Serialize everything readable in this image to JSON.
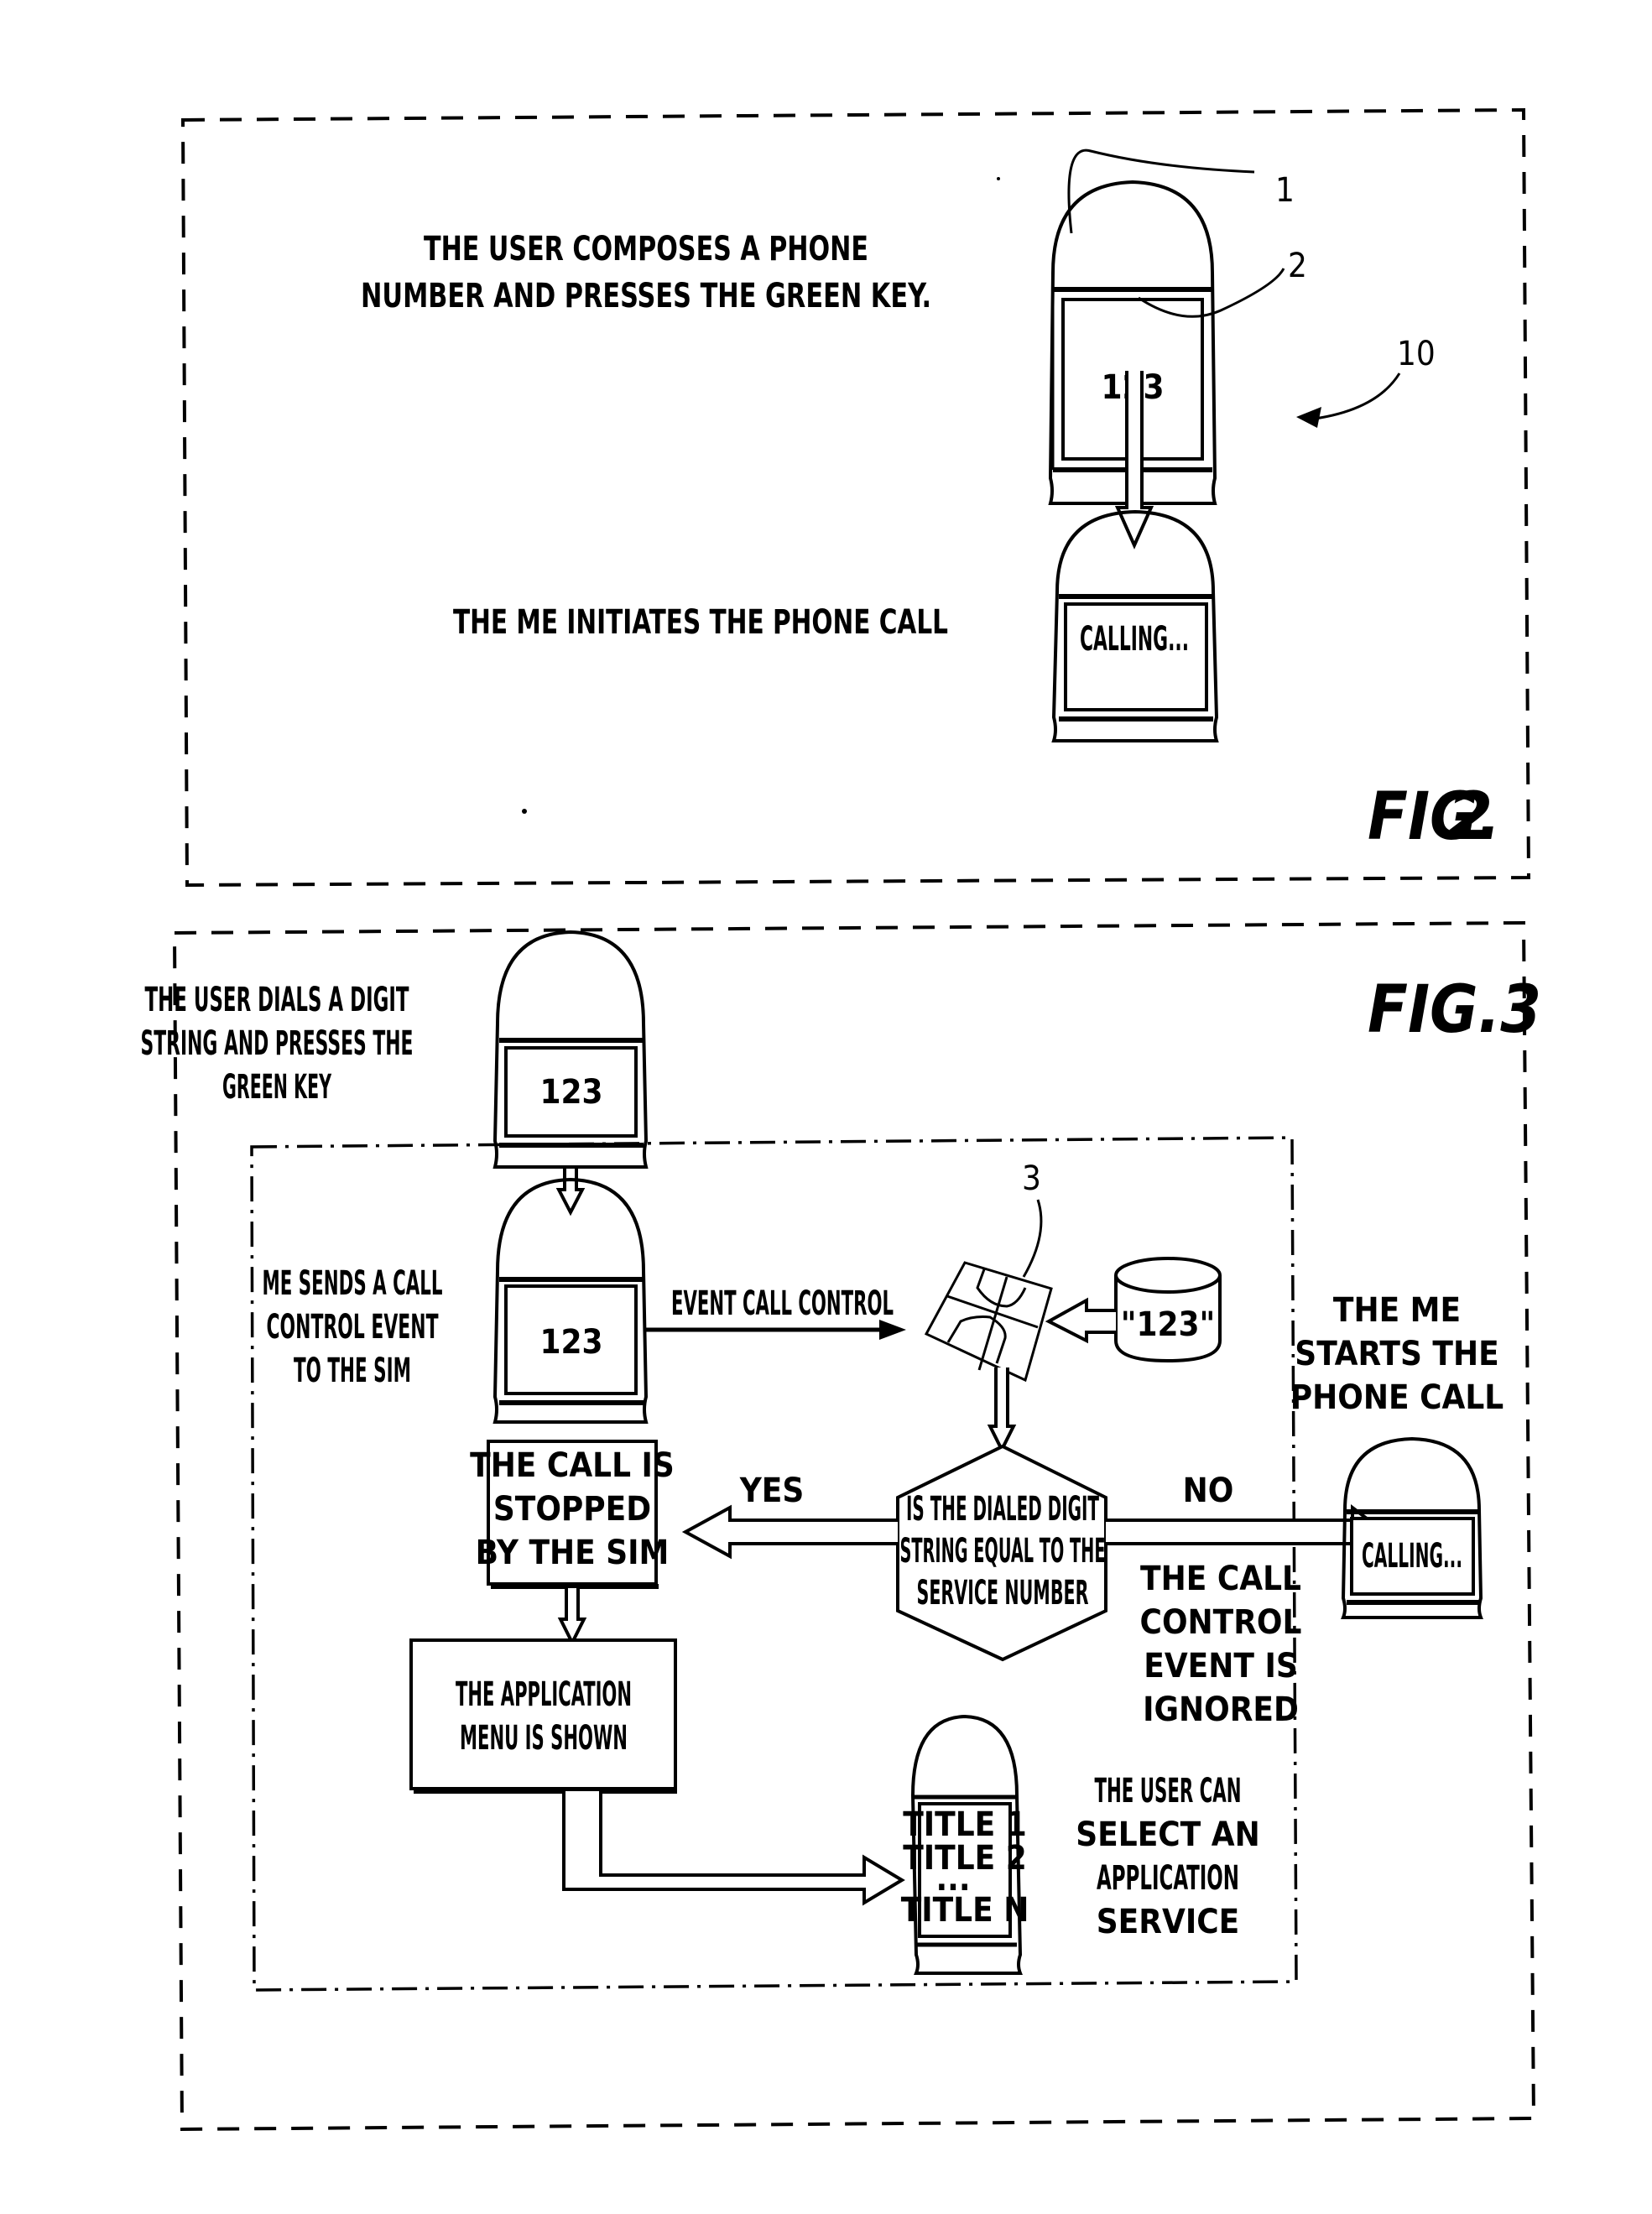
{
  "fig2": {
    "label": "FIG. 2",
    "label_prefix": "FIG.",
    "label_num": "2",
    "step1_text": [
      "THE USER COMPOSES A PHONE",
      "NUMBER AND PRESSES THE GREEN KEY."
    ],
    "phone1_screen": "123",
    "step2_text": "THE ME INITIATES THE PHONE CALL",
    "phone2_screen": "CALLING...",
    "ref_phone": "1",
    "ref_screen": "2",
    "ref_system": "10"
  },
  "fig3": {
    "label": "FIG.3",
    "dial_text": [
      "THE USER DIALS A DIGIT",
      "STRING AND PRESSES THE",
      "GREEN KEY"
    ],
    "dial_screen": "123",
    "send_text": [
      "ME SENDS A CALL",
      "CONTROL EVENT",
      "TO THE SIM"
    ],
    "send_screen": "123",
    "event_label": "EVENT CALL CONTROL",
    "sim_ref": "3",
    "db_value": "\"123\"",
    "decision_text": [
      "IS THE DIALED DIGIT",
      "STRING EQUAL TO THE",
      "SERVICE NUMBER"
    ],
    "yes_label": "YES",
    "no_label": "NO",
    "stopped_text": [
      "THE CALL IS",
      "STOPPED",
      "BY THE SIM"
    ],
    "menu_text": [
      "THE APPLICATION",
      "MENU IS SHOWN"
    ],
    "start_text": [
      "THE ME",
      "STARTS THE",
      "PHONE CALL"
    ],
    "calling_screen": "CALLING...",
    "ignored_text": [
      "THE CALL",
      "CONTROL",
      "EVENT IS",
      "IGNORED"
    ],
    "menu_items": [
      "TITLE 1",
      "TITLE 2",
      "...",
      "TITLE N"
    ],
    "select_text": [
      "THE USER CAN",
      "SELECT AN",
      "APPLICATION",
      "SERVICE"
    ]
  }
}
